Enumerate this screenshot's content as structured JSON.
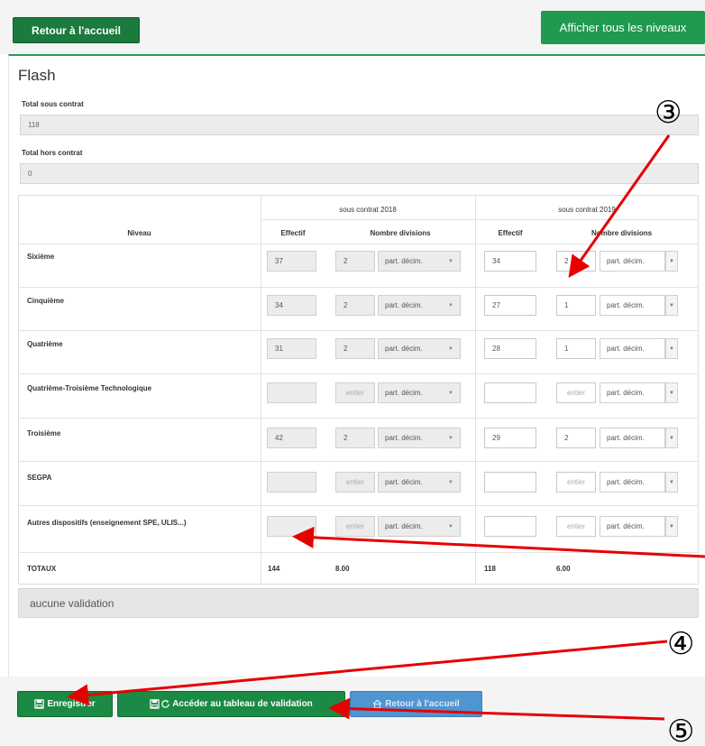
{
  "topbar": {
    "back_label": "Retour à l'accueil",
    "show_all_label": "Afficher tous les niveaux"
  },
  "panel": {
    "title": "Flash",
    "total_sous_contrat_label": "Total sous contrat",
    "total_sous_contrat_value": "118",
    "total_hors_contrat_label": "Total hors contrat",
    "total_hors_contrat_value": "0"
  },
  "table": {
    "group_2018": "sous contrat 2018",
    "group_2019": "sous contrat 2019",
    "col_niveau": "Niveau",
    "col_effectif": "Effectif",
    "col_divisions": "Nombre divisions",
    "decimal_label": "part. décim.",
    "entier_placeholder": "entier",
    "rows": [
      {
        "niveau": "Sixième",
        "eff2018": "37",
        "div2018": "2",
        "eff2019": "34",
        "div2019": "2"
      },
      {
        "niveau": "Cinquième",
        "eff2018": "34",
        "div2018": "2",
        "eff2019": "27",
        "div2019": "1"
      },
      {
        "niveau": "Quatrième",
        "eff2018": "31",
        "div2018": "2",
        "eff2019": "28",
        "div2019": "1"
      },
      {
        "niveau": "Quatrième-Troisième Technologique",
        "eff2018": "",
        "div2018": "",
        "eff2019": "",
        "div2019": ""
      },
      {
        "niveau": "Troisième",
        "eff2018": "42",
        "div2018": "2",
        "eff2019": "29",
        "div2019": "2"
      },
      {
        "niveau": "SEGPA",
        "eff2018": "",
        "div2018": "",
        "eff2019": "",
        "div2019": ""
      },
      {
        "niveau": "Autres dispositifs (enseignement SPE, ULIS...)",
        "eff2018": "",
        "div2018": "",
        "eff2019": "",
        "div2019": ""
      }
    ],
    "totals": {
      "label": "TOTAUX",
      "eff2018": "144",
      "div2018": "8.00",
      "eff2019": "118",
      "div2019": "6.00"
    }
  },
  "validation_status": "aucune validation",
  "footer": {
    "save_label": "Enregistrer",
    "validation_table_label": "Accéder au tableau de validation",
    "home_label": "Retour à l'accueil"
  },
  "annotations": {
    "marker_3": "③",
    "marker_4": "④",
    "marker_5": "⑤",
    "color": "#e60000"
  },
  "icons": {
    "save": "floppy-disk-icon",
    "validation": "floppy-refresh-icon",
    "home": "home-icon",
    "caret": "caret-down-icon"
  }
}
